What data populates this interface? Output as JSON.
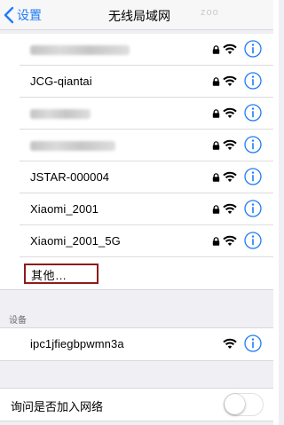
{
  "navbar": {
    "back_label": "设置",
    "title": "无线局域网",
    "watermark": "zoo"
  },
  "networks": [
    {
      "ssid": "",
      "obscured": true,
      "blur_width": 112,
      "secured": true
    },
    {
      "ssid": "JCG-qiantai",
      "obscured": false,
      "secured": true
    },
    {
      "ssid": "",
      "obscured": true,
      "blur_width": 68,
      "secured": true
    },
    {
      "ssid": "",
      "obscured": true,
      "blur_width": 96,
      "secured": true
    },
    {
      "ssid": "JSTAR-000004",
      "obscured": false,
      "secured": true
    },
    {
      "ssid": "Xiaomi_2001",
      "obscured": false,
      "secured": true
    },
    {
      "ssid": "Xiaomi_2001_5G",
      "obscured": false,
      "secured": true
    }
  ],
  "other_label": "其他…",
  "devices_section": {
    "header": "设备",
    "items": [
      {
        "ssid": "ipc1jfiegbpwmn3a",
        "secured": false
      }
    ]
  },
  "ask_to_join": {
    "label": "询问是否加入网络",
    "enabled": false
  },
  "colors": {
    "accent": "#1f7cf6",
    "background": "#efeff4",
    "highlight_box": "#8c1c1c"
  },
  "icons": {
    "back": "chevron-left-icon",
    "lock": "lock-icon",
    "wifi": "wifi-icon",
    "info": "info-icon"
  }
}
